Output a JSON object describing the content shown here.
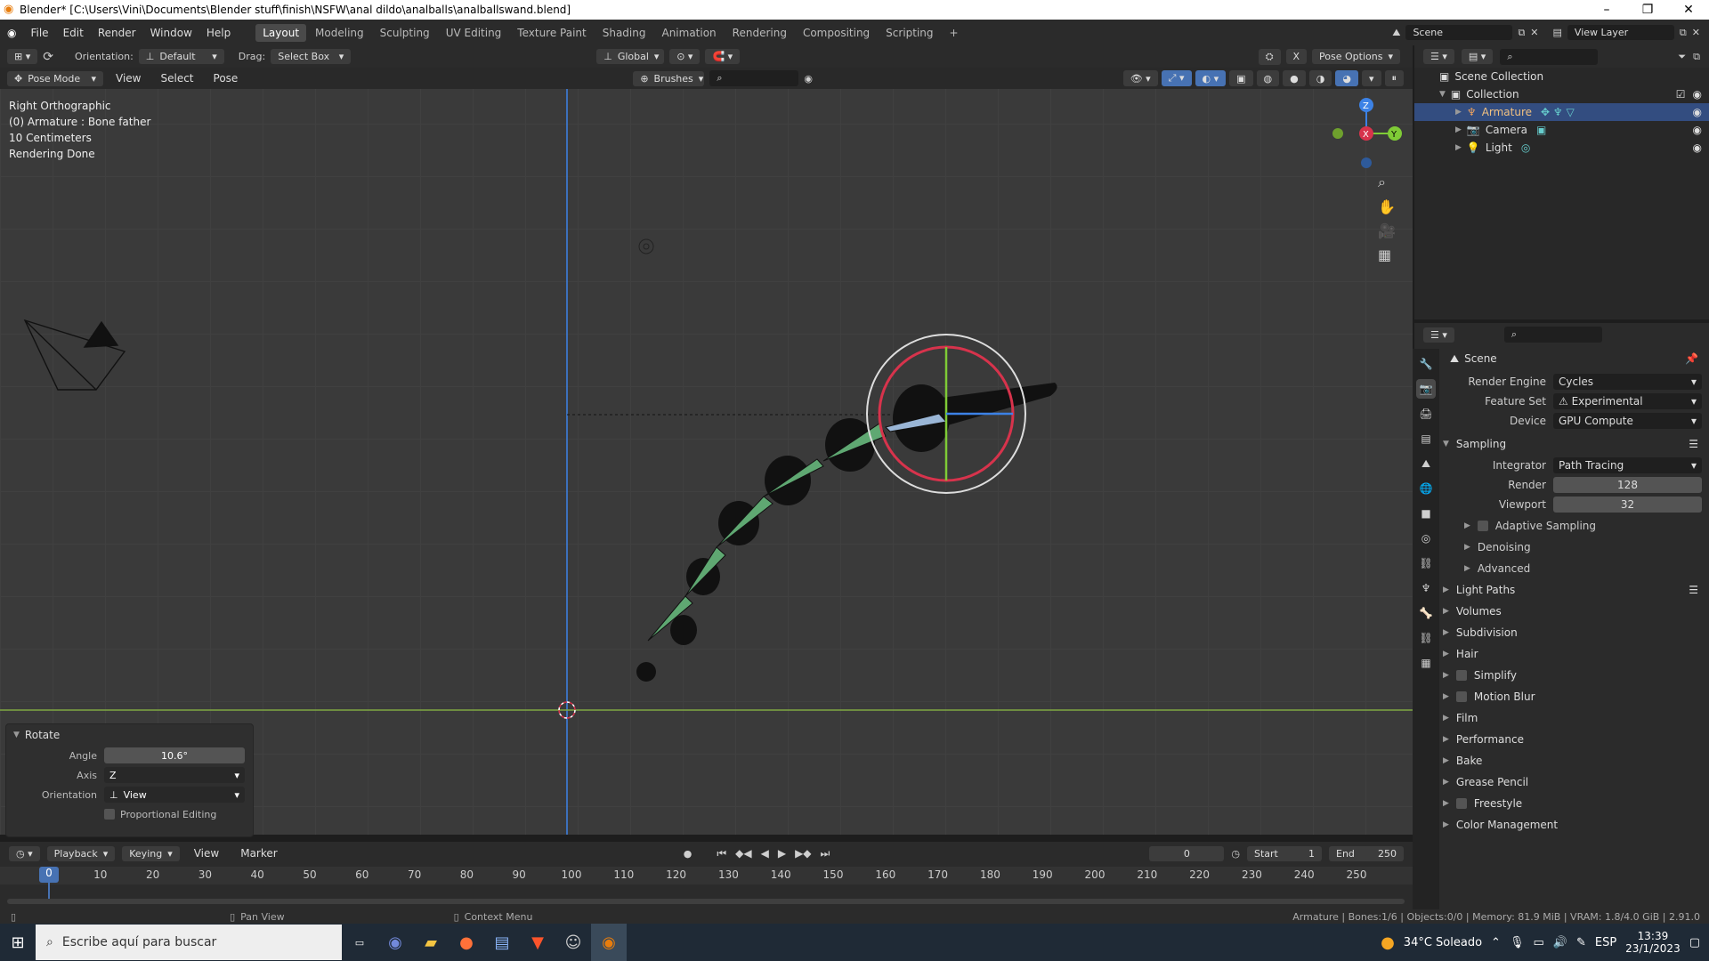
{
  "title": "Blender* [C:\\Users\\Vini\\Documents\\Blender stuff\\finish\\NSFW\\anal dildo\\analballs\\analballswand.blend]",
  "menu": [
    "File",
    "Edit",
    "Render",
    "Window",
    "Help"
  ],
  "workspaces": [
    "Layout",
    "Modeling",
    "Sculpting",
    "UV Editing",
    "Texture Paint",
    "Shading",
    "Animation",
    "Rendering",
    "Compositing",
    "Scripting",
    "+"
  ],
  "scene_name": "Scene",
  "view_layer": "View Layer",
  "header": {
    "orientation_label": "Orientation:",
    "orientation_value": "Default",
    "drag_label": "Drag:",
    "drag_value": "Select Box",
    "transform": "Global",
    "pose_options": "Pose Options",
    "mode": "Pose Mode",
    "view": "View",
    "select": "Select",
    "pose": "Pose",
    "brushes": "Brushes"
  },
  "viewport_info": [
    "Right Orthographic",
    "(0) Armature : Bone father",
    "10 Centimeters",
    "Rendering Done"
  ],
  "rotate_panel": {
    "title": "Rotate",
    "angle_label": "Angle",
    "angle": "10.6°",
    "axis_label": "Axis",
    "axis": "Z",
    "orientation_label": "Orientation",
    "orientation": "View",
    "proportional": "Proportional Editing"
  },
  "timeline": {
    "playback": "Playback",
    "keying": "Keying",
    "view": "View",
    "marker": "Marker",
    "current_frame": "0",
    "start_label": "Start",
    "start": "1",
    "end_label": "End",
    "end": "250",
    "indicator": "0",
    "ticks": [
      "10",
      "20",
      "30",
      "40",
      "50",
      "60",
      "70",
      "80",
      "90",
      "100",
      "110",
      "120",
      "130",
      "140",
      "150",
      "160",
      "170",
      "180",
      "190",
      "200",
      "210",
      "220",
      "230",
      "240",
      "250"
    ]
  },
  "statusbar": {
    "pan": "Pan View",
    "context": "Context Menu",
    "stats": "Armature | Bones:1/6 | Objects:0/0 | Memory: 81.9 MiB | VRAM: 1.8/4.0 GiB | 2.91.0"
  },
  "outliner": {
    "root": "Scene Collection",
    "collection": "Collection",
    "items": [
      "Armature",
      "Camera",
      "Light"
    ]
  },
  "properties": {
    "scene": "Scene",
    "render_engine_label": "Render Engine",
    "render_engine": "Cycles",
    "feature_set_label": "Feature Set",
    "feature_set": "Experimental",
    "device_label": "Device",
    "device": "GPU Compute",
    "sampling": "Sampling",
    "integrator_label": "Integrator",
    "integrator": "Path Tracing",
    "render_label": "Render",
    "render_samples": "128",
    "viewport_label": "Viewport",
    "viewport_samples": "32",
    "subsections": [
      "Adaptive Sampling",
      "Denoising",
      "Advanced"
    ],
    "sections": [
      "Light Paths",
      "Volumes",
      "Subdivision",
      "Hair",
      "Simplify",
      "Motion Blur",
      "Film",
      "Performance",
      "Bake",
      "Grease Pencil",
      "Freestyle",
      "Color Management"
    ]
  },
  "taskbar": {
    "search_placeholder": "Escribe aquí para buscar",
    "weather": "34°C  Soleado",
    "lang": "ESP",
    "time": "13:39",
    "date": "23/1/2023"
  },
  "colors": {
    "accent": "#4772b3",
    "selection": "#334d80",
    "bone": "#5fa872",
    "gizmo_red": "#d7334c",
    "gizmo_green": "#7fcb36",
    "gizmo_blue": "#3c82e6"
  }
}
